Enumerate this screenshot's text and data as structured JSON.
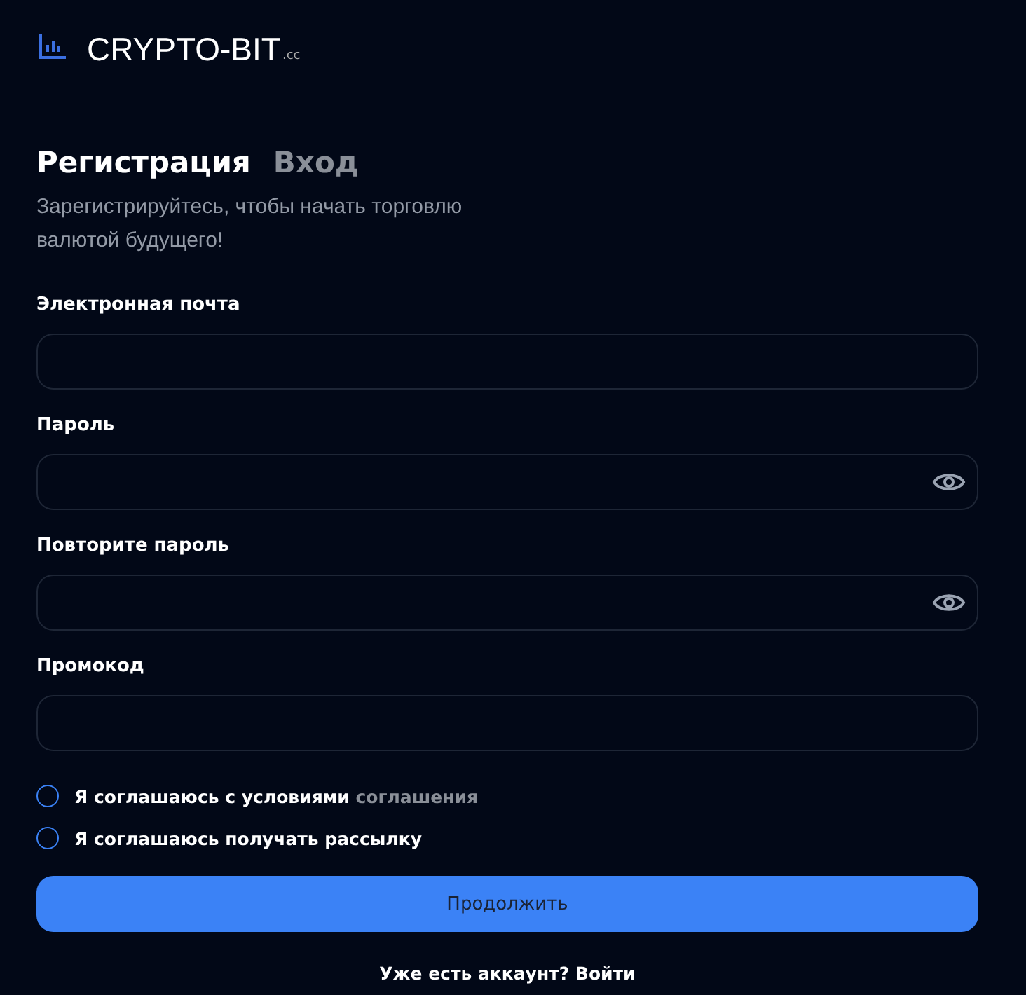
{
  "logo": {
    "name": "CRYPTO-BIT",
    "suffix": ".cc"
  },
  "tabs": [
    {
      "label": "Регистрация",
      "selected": true
    },
    {
      "label": "Вход",
      "selected": false
    }
  ],
  "subtitle": "Зарегистрируйтесь, чтобы начать торговлю валютой будущего!",
  "fields": [
    {
      "label": "Электронная почта",
      "kind": "text"
    },
    {
      "label": "Пароль",
      "kind": "password"
    },
    {
      "label": "Повторите пароль",
      "kind": "password"
    },
    {
      "label": "Промокод",
      "kind": "text"
    }
  ],
  "agreements": [
    {
      "text": "Я соглашаюсь с условиями",
      "link": "соглашения",
      "checked": false
    },
    {
      "text": "Я соглашаюсь получать рассылку",
      "checked": false
    }
  ],
  "submit": "Продолжить",
  "footer": "Уже есть аккаунт? Войти"
}
